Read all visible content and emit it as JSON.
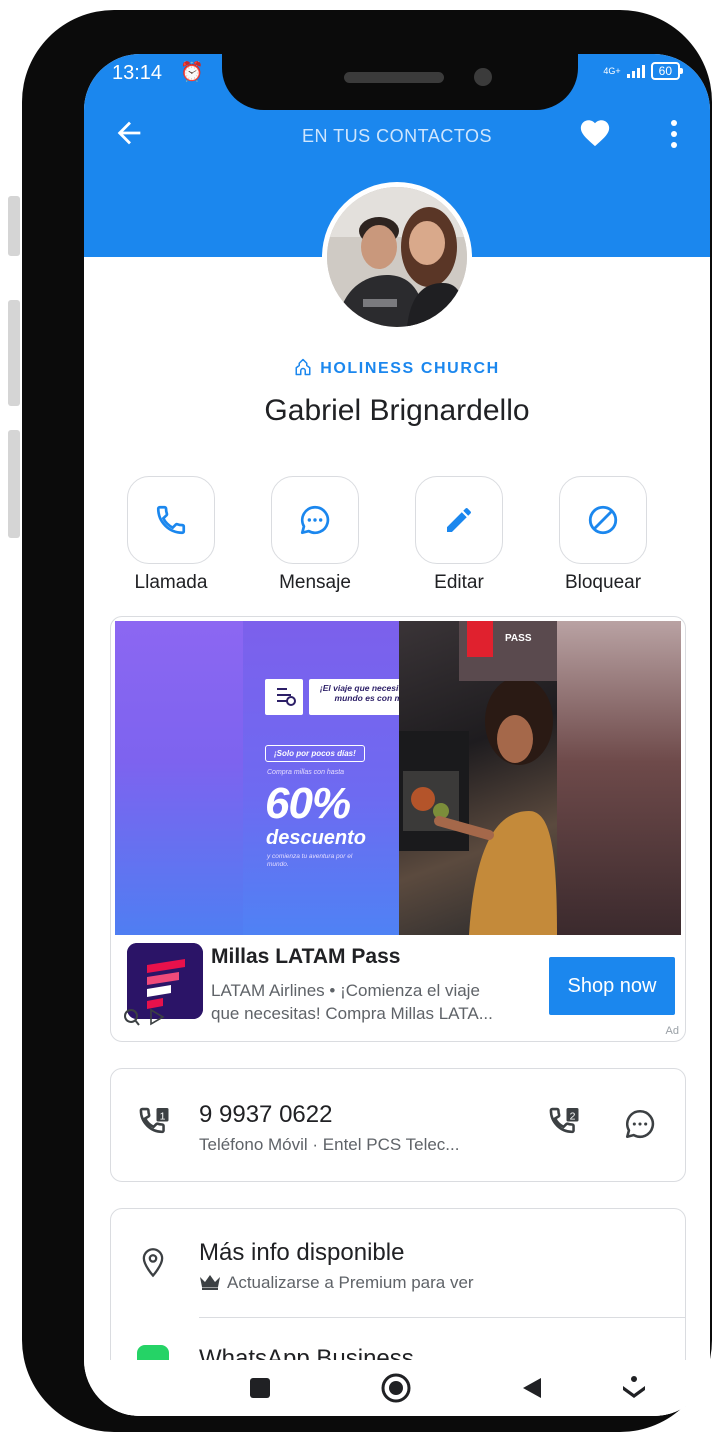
{
  "status_bar": {
    "time": "13:14",
    "network": "4G+",
    "battery": "60"
  },
  "header": {
    "title": "EN TUS CONTACTOS"
  },
  "contact": {
    "organization": "HOLINESS CHURCH",
    "name": "Gabriel Brignardello"
  },
  "actions": [
    {
      "label": "Llamada",
      "icon": "phone-icon"
    },
    {
      "label": "Mensaje",
      "icon": "chat-bubble-icon"
    },
    {
      "label": "Editar",
      "icon": "pencil-icon"
    },
    {
      "label": "Bloquear",
      "icon": "block-icon"
    }
  ],
  "ad": {
    "banner": {
      "headline": "¡El viaje que necesitas por el mundo es con millas!",
      "promo_tag": "¡Solo por pocos días!",
      "promo_line": "Compra millas con hasta",
      "percent": "60%",
      "discount": "descuento",
      "tagline": "y comienza tu aventura por el mundo.",
      "brand": "PASS"
    },
    "title": "Millas LATAM Pass",
    "body_line1": "LATAM Airlines • ¡Comienza el viaje",
    "body_line2": "que necesitas! Compra Millas LATA...",
    "cta": "Shop now",
    "tag": "Ad"
  },
  "phone": {
    "number": "9 9937 0622",
    "type": "Teléfono Móvil · Entel PCS Telec..."
  },
  "more_info": {
    "title": "Más info disponible",
    "subtitle": "Actualizarse a Premium para ver",
    "next_item": "WhatsApp Business"
  },
  "colors": {
    "primary": "#1b87ee",
    "text": "#202124",
    "secondary_text": "#5f6368",
    "border": "#dadce0",
    "whatsapp": "#25d366"
  }
}
